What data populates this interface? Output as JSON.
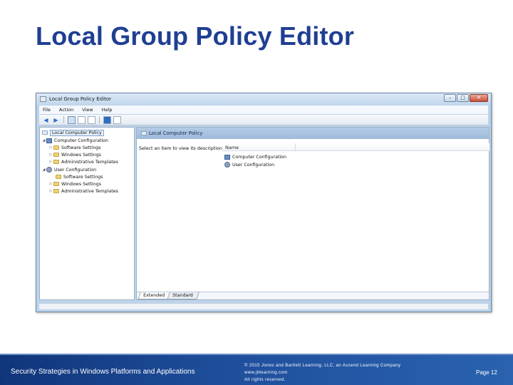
{
  "slide": {
    "title": "Local Group Policy Editor"
  },
  "window": {
    "title": "Local Group Policy Editor",
    "controls": {
      "minimize": "–",
      "maximize": "□",
      "close": "✕"
    },
    "menu": [
      "File",
      "Action",
      "View",
      "Help"
    ],
    "tree": {
      "root": "Local Computer Policy",
      "computer_configuration": "Computer Configuration",
      "computer_children": [
        "Software Settings",
        "Windows Settings",
        "Administrative Templates"
      ],
      "user_configuration": "User Configuration",
      "user_children": [
        "Software Settings",
        "Windows Settings",
        "Administrative Templates"
      ]
    },
    "right_pane": {
      "header": "Local Computer Policy",
      "description": "Select an item to view its description.",
      "column_name": "Name",
      "items": [
        "Computer Configuration",
        "User Configuration"
      ],
      "tabs": [
        "Extended",
        "Standard"
      ]
    }
  },
  "footer": {
    "course": "Security Strategies in Windows Platforms and Applications",
    "copyright_line1": "© 2015 Jones and Bartlett Learning, LLC, an Ascend Learning Company",
    "copyright_line2": "www.jblearning.com",
    "copyright_line3": "All rights reserved.",
    "page": "Page 12"
  },
  "colors": {
    "title": "#1f3f93",
    "footer_bg": "#1f4f9c"
  }
}
